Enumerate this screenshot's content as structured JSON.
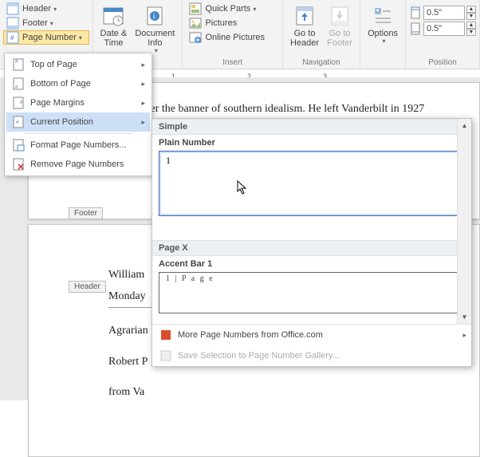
{
  "ribbon": {
    "hf": {
      "header": "Header",
      "footer": "Footer",
      "pagenum": "Page Number"
    },
    "dt": {
      "datetime": "Date &\nTime",
      "docinfo": "Document\nInfo"
    },
    "ins": {
      "quickparts": "Quick Parts",
      "pictures": "Pictures",
      "online": "Online Pictures",
      "group": "Insert"
    },
    "nav": {
      "gohdr": "Go to\nHeader",
      "goftr": "Go to\nFooter",
      "group": "Navigation"
    },
    "opt": {
      "options": "Options"
    },
    "pos": {
      "top": "0.5\"",
      "bot": "0.5\"",
      "group": "Position"
    }
  },
  "ruler": {
    "m1": "1",
    "m2": "2",
    "m3": "3"
  },
  "menu": {
    "top": "Top of Page",
    "bottom": "Bottom of Page",
    "margins": "Page Margins",
    "current": "Current Position",
    "format": "Format Page Numbers...",
    "remove": "Remove Page Numbers"
  },
  "gallery": {
    "cat1": "Simple",
    "item1": "Plain Number",
    "item1_val": "1",
    "cat2": "Page X",
    "item2": "Accent Bar 1",
    "item2_val": "1 | P a g e",
    "more": "More Page Numbers from Office.com",
    "save": "Save Selection to Page Number Gallery..."
  },
  "doc": {
    "p1_line": "ating under the banner of southern idealism.  He left Vanderbilt in 1927",
    "footer_tag": "Footer",
    "header_tag": "Header",
    "p2_l1": "William",
    "p2_l2": "Monday",
    "p2_l3": "Agrarian",
    "p2_l4": "Robert P",
    "p2_l5": "from Va"
  }
}
